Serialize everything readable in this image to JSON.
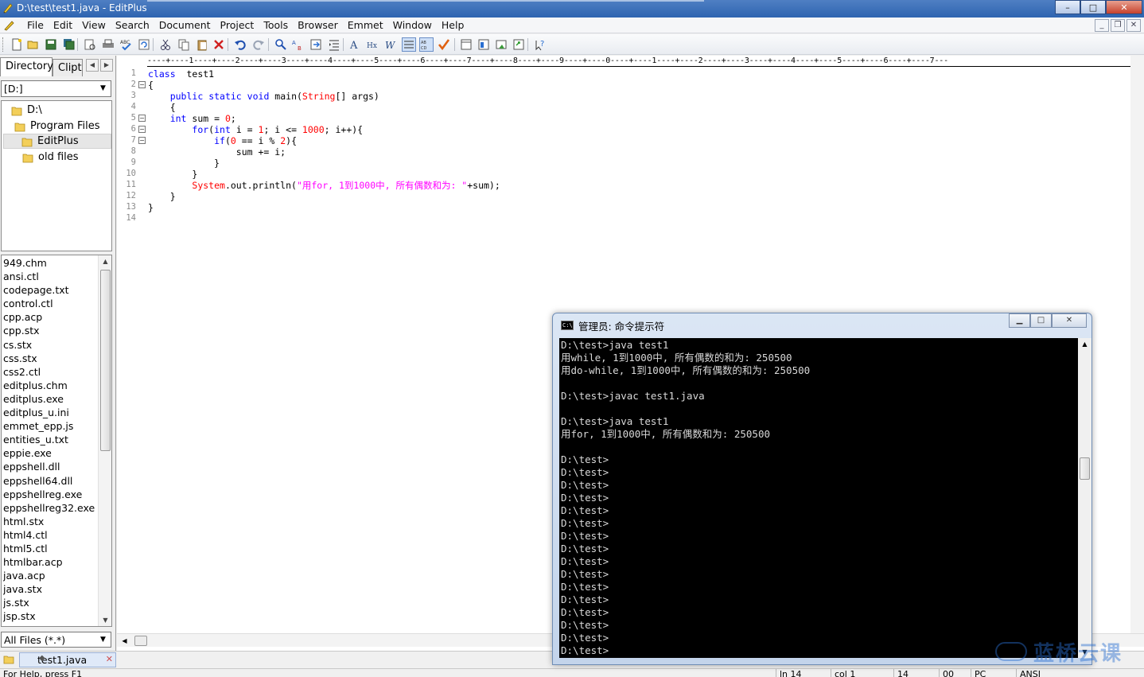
{
  "window": {
    "title": "D:\\test\\test1.java - EditPlus",
    "minimize": "–",
    "maximize": "□",
    "close": "✕"
  },
  "menu": {
    "items": [
      "File",
      "Edit",
      "View",
      "Search",
      "Document",
      "Project",
      "Tools",
      "Browser",
      "Emmet",
      "Window",
      "Help"
    ]
  },
  "toolbar": {
    "icons": [
      "new-file-icon",
      "open-icon",
      "save-icon",
      "save-all-icon",
      "print-preview-icon",
      "print-icon",
      "spellcheck-icon",
      "reload-icon",
      "cut-icon",
      "copy-icon",
      "paste-icon",
      "delete-icon",
      "undo-icon",
      "redo-icon",
      "find-icon",
      "replace-icon",
      "goto-icon",
      "indent-icon",
      "font-icon",
      "hex-icon",
      "word-wrap-icon",
      "line-numbers-icon",
      "ruler-icon",
      "check-icon",
      "directory-icon",
      "output-icon",
      "browser-preview-icon",
      "run-icon",
      "help-icon"
    ]
  },
  "left_panel": {
    "tabs": [
      "Directory",
      "Clipt"
    ],
    "drive": "[D:]",
    "tree": [
      "D:\\",
      "Program Files",
      "EditPlus",
      "old files"
    ],
    "files": [
      "949.chm",
      "ansi.ctl",
      "codepage.txt",
      "control.ctl",
      "cpp.acp",
      "cpp.stx",
      "cs.stx",
      "css.stx",
      "css2.ctl",
      "editplus.chm",
      "editplus.exe",
      "editplus_u.ini",
      "emmet_epp.js",
      "entities_u.txt",
      "eppie.exe",
      "eppshell.dll",
      "eppshell64.dll",
      "eppshellreg.exe",
      "eppshellreg32.exe",
      "html.stx",
      "html4.ctl",
      "html5.ctl",
      "htmlbar.acp",
      "java.acp",
      "java.stx",
      "js.stx",
      "jsp.stx"
    ],
    "filter": "All Files (*.*)"
  },
  "editor": {
    "ruler": "----+----1----+----2----+----3----+----4----+----5----+----6----+----7----+----8----+----9----+----0----+----1----+----2----+----3----+----4----+----5----+----6----+----7---",
    "line_numbers": [
      "1",
      "2",
      "3",
      "4",
      "5",
      "6",
      "7",
      "8",
      "9",
      "10",
      "11",
      "12",
      "13",
      "14"
    ],
    "lines": [
      [
        {
          "t": "class",
          "c": "kw"
        },
        {
          "t": "  test1",
          "c": ""
        }
      ],
      [
        {
          "t": "{",
          "c": ""
        }
      ],
      [
        {
          "t": "    ",
          "c": ""
        },
        {
          "t": "public",
          "c": "kw"
        },
        {
          "t": " ",
          "c": ""
        },
        {
          "t": "static",
          "c": "kw"
        },
        {
          "t": " ",
          "c": ""
        },
        {
          "t": "void",
          "c": "kw"
        },
        {
          "t": " main(",
          "c": ""
        },
        {
          "t": "String",
          "c": "cls"
        },
        {
          "t": "[] args)",
          "c": ""
        }
      ],
      [
        {
          "t": "    {",
          "c": ""
        }
      ],
      [
        {
          "t": "    ",
          "c": ""
        },
        {
          "t": "int",
          "c": "kw"
        },
        {
          "t": " sum = ",
          "c": ""
        },
        {
          "t": "0",
          "c": "num"
        },
        {
          "t": ";",
          "c": ""
        }
      ],
      [
        {
          "t": "        ",
          "c": ""
        },
        {
          "t": "for",
          "c": "kw"
        },
        {
          "t": "(",
          "c": ""
        },
        {
          "t": "int",
          "c": "kw"
        },
        {
          "t": " i = ",
          "c": ""
        },
        {
          "t": "1",
          "c": "num"
        },
        {
          "t": "; i <= ",
          "c": ""
        },
        {
          "t": "1000",
          "c": "num"
        },
        {
          "t": "; i++){",
          "c": ""
        }
      ],
      [
        {
          "t": "            ",
          "c": ""
        },
        {
          "t": "if",
          "c": "kw"
        },
        {
          "t": "(",
          "c": ""
        },
        {
          "t": "0",
          "c": "num"
        },
        {
          "t": " == i % ",
          "c": ""
        },
        {
          "t": "2",
          "c": "num"
        },
        {
          "t": "){",
          "c": ""
        }
      ],
      [
        {
          "t": "                sum += i;",
          "c": ""
        }
      ],
      [
        {
          "t": "            }",
          "c": ""
        }
      ],
      [
        {
          "t": "        }",
          "c": ""
        }
      ],
      [
        {
          "t": "        ",
          "c": ""
        },
        {
          "t": "System",
          "c": "cls"
        },
        {
          "t": ".out.println(",
          "c": ""
        },
        {
          "t": "\"用for, 1到1000中, 所有偶数和为: \"",
          "c": "str"
        },
        {
          "t": "+sum);",
          "c": ""
        }
      ],
      [
        {
          "t": "    }",
          "c": ""
        }
      ],
      [
        {
          "t": "}",
          "c": ""
        }
      ],
      [
        {
          "t": "",
          "c": ""
        }
      ]
    ],
    "folds": [
      2,
      5,
      6,
      7
    ]
  },
  "doc_tabs": {
    "active": "test1.java",
    "modified_mark": "◆"
  },
  "statusbar": {
    "help": "For Help, press F1",
    "line": "ln 14",
    "col": "col 1",
    "total": "14",
    "hex": "00",
    "mode": "PC",
    "encoding": "ANSI"
  },
  "console": {
    "title": "管理员: 命令提示符",
    "lines": [
      "D:\\test>java test1",
      "用while, 1到1000中, 所有偶数的和为: 250500",
      "用do-while, 1到1000中, 所有偶数的和为: 250500",
      "",
      "D:\\test>javac test1.java",
      "",
      "D:\\test>java test1",
      "用for, 1到1000中, 所有偶数和为: 250500",
      "",
      "D:\\test>",
      "D:\\test>",
      "D:\\test>",
      "D:\\test>",
      "D:\\test>",
      "D:\\test>",
      "D:\\test>",
      "D:\\test>",
      "D:\\test>",
      "D:\\test>",
      "D:\\test>",
      "D:\\test>",
      "D:\\test>",
      "D:\\test>",
      "D:\\test>",
      "D:\\test>"
    ]
  },
  "watermark": {
    "text": "蓝桥云课"
  }
}
